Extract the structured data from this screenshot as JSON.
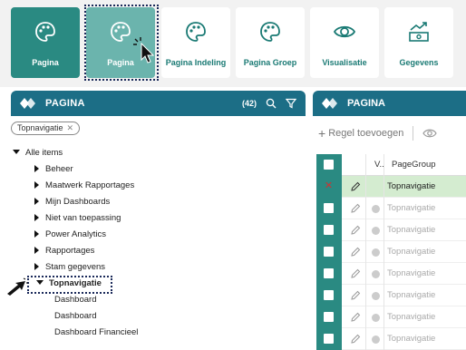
{
  "tiles": [
    {
      "label": "Pagina",
      "icon": "palette-icon",
      "state": "active"
    },
    {
      "label": "Pagina",
      "icon": "palette-icon",
      "state": "hover"
    },
    {
      "label": "Pagina Indeling",
      "icon": "palette-icon",
      "state": "normal"
    },
    {
      "label": "Pagina Groep",
      "icon": "palette-icon",
      "state": "normal"
    },
    {
      "label": "Visualisatie",
      "icon": "eye-icon",
      "state": "normal"
    },
    {
      "label": "Gegevens",
      "icon": "money-chart-icon",
      "state": "normal"
    }
  ],
  "left_panel": {
    "title": "PAGINA",
    "count": "(42)",
    "filter_chip": "Topnavigatie",
    "tree_root": "Alle items",
    "tree_items": [
      "Beheer",
      "Maatwerk Rapportages",
      "Mijn Dashboards",
      "Niet van toepassing",
      "Power Analytics",
      "Rapportages",
      "Stam gegevens"
    ],
    "expanded_item": "Topnavigatie",
    "children": [
      "Dashboard",
      "Dashboard",
      "Dashboard Financieel"
    ]
  },
  "right_panel": {
    "title": "PAGINA",
    "add_row": "Regel toevoegen",
    "col_v": "V..",
    "col_pagegroup": "PageGroup",
    "rows": [
      "Topnavigatie",
      "Topnavigatie",
      "Topnavigatie",
      "Topnavigatie",
      "Topnavigatie",
      "Topnavigatie",
      "Topnavigatie",
      "Topnavigatie"
    ]
  },
  "colors": {
    "teal": "#2a8a82",
    "header": "#1c6e86",
    "selected_row": "#d4ecd0"
  }
}
